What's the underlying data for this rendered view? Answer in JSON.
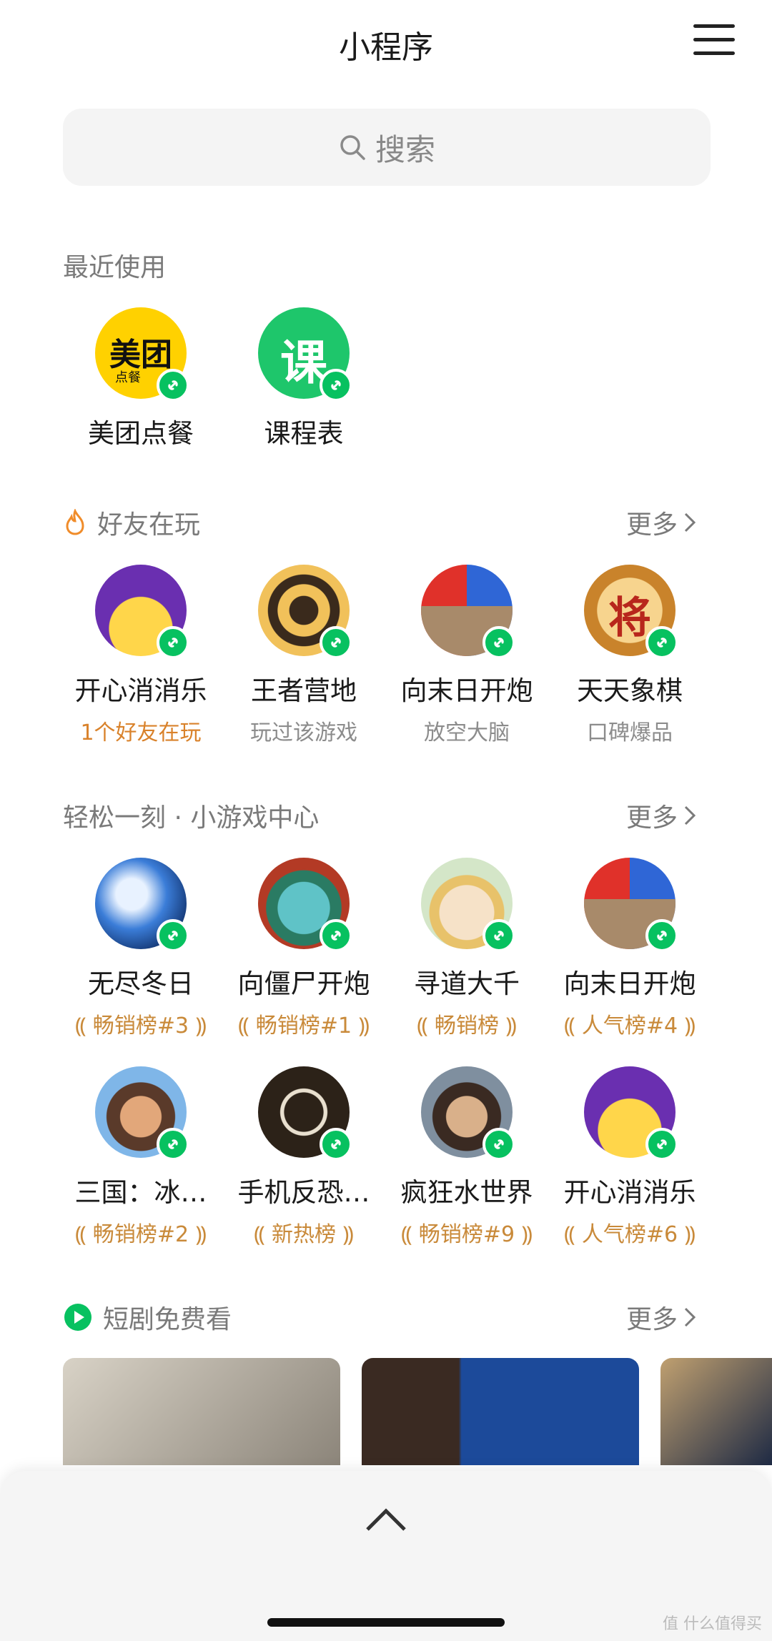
{
  "header": {
    "title": "小程序"
  },
  "search": {
    "placeholder": "搜索"
  },
  "recent": {
    "title": "最近使用",
    "items": [
      {
        "name": "美团点餐",
        "icon": "meituan-logo"
      },
      {
        "name": "课程表",
        "icon": "course-logo"
      }
    ]
  },
  "friends": {
    "title": "好友在玩",
    "more": "更多",
    "items": [
      {
        "name": "开心消消乐",
        "sub": "1个好友在玩"
      },
      {
        "name": "王者营地",
        "sub": "玩过该游戏"
      },
      {
        "name": "向末日开炮",
        "sub": "放空大脑"
      },
      {
        "name": "天天象棋",
        "sub": "口碑爆品"
      }
    ]
  },
  "games": {
    "title": "轻松一刻 · 小游戏中心",
    "more": "更多",
    "row1": [
      {
        "name": "无尽冬日",
        "rank": "畅销榜#3"
      },
      {
        "name": "向僵尸开炮",
        "rank": "畅销榜#1"
      },
      {
        "name": "寻道大千",
        "rank": "畅销榜"
      },
      {
        "name": "向末日开炮",
        "rank": "人气榜#4"
      }
    ],
    "row2": [
      {
        "name": "三国：冰…",
        "rank": "畅销榜#2"
      },
      {
        "name": "手机反恐…",
        "rank": "新热榜"
      },
      {
        "name": "疯狂水世界",
        "rank": "畅销榜#9"
      },
      {
        "name": "开心消消乐",
        "rank": "人气榜#6"
      }
    ]
  },
  "drama": {
    "title": "短剧免费看",
    "more": "更多"
  },
  "colors": {
    "wechat_green": "#07c160",
    "rank_gold": "#c98a3a",
    "friend_orange": "#d9822b"
  },
  "watermark": "值 什么值得买"
}
